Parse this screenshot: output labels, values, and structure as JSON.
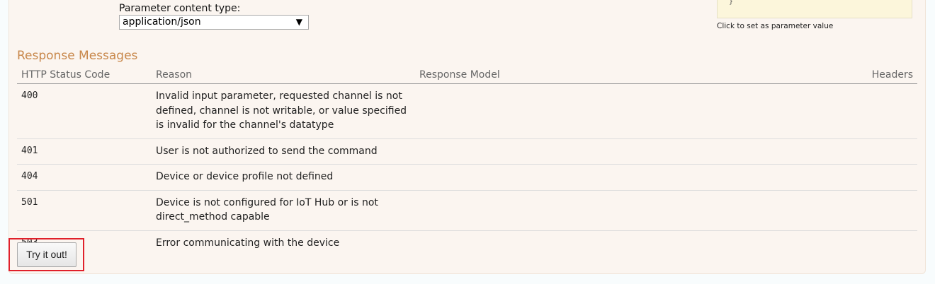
{
  "parameter": {
    "content_type_label": "Parameter content type:",
    "content_type_value": "application/json",
    "sample_snippet": "}",
    "sample_hint": "Click to set as parameter value"
  },
  "responses": {
    "title": "Response Messages",
    "columns": [
      "HTTP Status Code",
      "Reason",
      "Response Model",
      "Headers"
    ],
    "rows": [
      {
        "code": "400",
        "reason": "Invalid input parameter, requested channel is not defined, channel is not writable, or value specified is invalid for the channel's datatype"
      },
      {
        "code": "401",
        "reason": "User is not authorized to send the command"
      },
      {
        "code": "404",
        "reason": "Device or device profile not defined"
      },
      {
        "code": "501",
        "reason": "Device is not configured for IoT Hub or is not direct_method capable"
      },
      {
        "code": "503",
        "reason": "Error communicating with the device"
      }
    ]
  },
  "actions": {
    "try_label": "Try it out!"
  },
  "colors": {
    "panel_bg": "#fbf5f0",
    "title": "#c8874a",
    "highlight": "#e0202a"
  },
  "icons": {
    "select_arrow": "dropdown-arrow-icon"
  }
}
